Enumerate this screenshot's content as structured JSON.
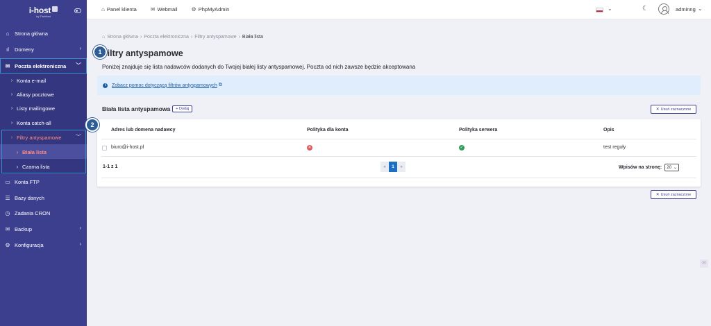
{
  "brand": {
    "name": "i-host",
    "sub": "by TheHost"
  },
  "sidebar": {
    "items": [
      {
        "label": "Strona główna",
        "icon": "home-icon"
      },
      {
        "label": "Domeny",
        "icon": "chart-icon"
      },
      {
        "label": "Poczta elektroniczna",
        "icon": "mail-icon"
      },
      {
        "label": "Konta e-mail"
      },
      {
        "label": "Aliasy pocztowe"
      },
      {
        "label": "Listy mailingowe"
      },
      {
        "label": "Konta catch-all"
      },
      {
        "label": "Filtry antyspamowe"
      },
      {
        "label": "Biała lista"
      },
      {
        "label": "Czarna lista"
      },
      {
        "label": "Konta FTP",
        "icon": "ftp-icon"
      },
      {
        "label": "Bazy danych",
        "icon": "database-icon"
      },
      {
        "label": "Zadania CRON",
        "icon": "clock-icon"
      },
      {
        "label": "Backup",
        "icon": "backup-icon"
      },
      {
        "label": "Konfiguracja",
        "icon": "gear-icon"
      }
    ]
  },
  "topbar": {
    "links": [
      "Panel klienta",
      "Webmail",
      "PhpMyAdmin"
    ],
    "username": "adminng"
  },
  "breadcrumb": [
    "Strona główna",
    "Poczta elektroniczna",
    "Filtry antyspamowe",
    "Biała lista"
  ],
  "page": {
    "title": "Filtry antyspamowe",
    "description": "Poniżej znajduje się lista nadawców dodanych do Twojej białej listy antyspamowej. Poczta od nich zawsze będzie akceptowana",
    "help_link": "Zobacz pomoc dotyczącą filtrów antyspamowych",
    "section_title": "Biała lista antyspamowa",
    "add_label": "Dodaj",
    "delete_label": "Usuń zaznaczone"
  },
  "table": {
    "headers": [
      "Adres lub domena nadawcy",
      "Polityka dla konta",
      "Polityka serwera",
      "Opis"
    ],
    "rows": [
      {
        "address": "biuro@i-host.pl",
        "account_policy": "blocked",
        "server_policy": "allowed",
        "description": "test reguły"
      }
    ],
    "count": "1-1 z 1",
    "pager": {
      "prev": "«",
      "page": "1",
      "next": "»"
    },
    "per_page_label": "Wpisów na stronę:",
    "per_page_value": "20"
  },
  "annotations": [
    "1",
    "2"
  ],
  "colors": {
    "sidebar": "#3c3f8e",
    "accent": "#1f6fc0",
    "active": "#ff8a80",
    "danger": "#e05a5a",
    "success": "#2f9e5b"
  }
}
